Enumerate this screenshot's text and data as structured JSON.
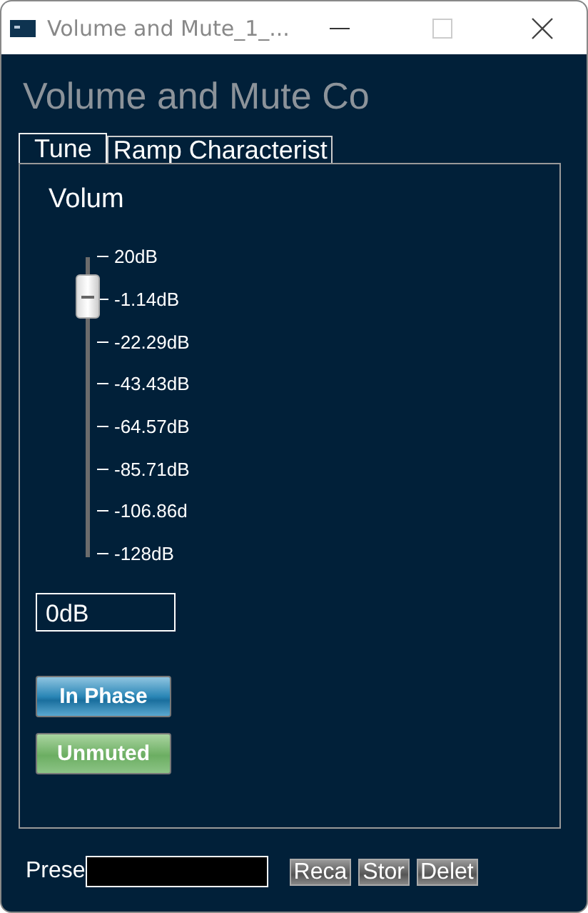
{
  "window": {
    "title": "Volume and Mute_1_..."
  },
  "heading": "Volume and Mute Co",
  "tabs": [
    {
      "label": "Tune",
      "selected": true
    },
    {
      "label": "Ramp Characterist",
      "selected": false
    }
  ],
  "volume": {
    "label": "Volum",
    "level": 0.87,
    "ticks": [
      "20dB",
      "-1.14dB",
      "-22.29dB",
      "-43.43dB",
      "-64.57dB",
      "-85.71dB",
      "-106.86d",
      "-128dB"
    ],
    "value": "0dB"
  },
  "phase_button": {
    "label": "In Phase",
    "on": false
  },
  "mute_button": {
    "label": "Unmuted",
    "on": false
  },
  "preset": {
    "label": "Prese",
    "buttons": [
      "Reca",
      "Stor",
      "Delet"
    ]
  }
}
